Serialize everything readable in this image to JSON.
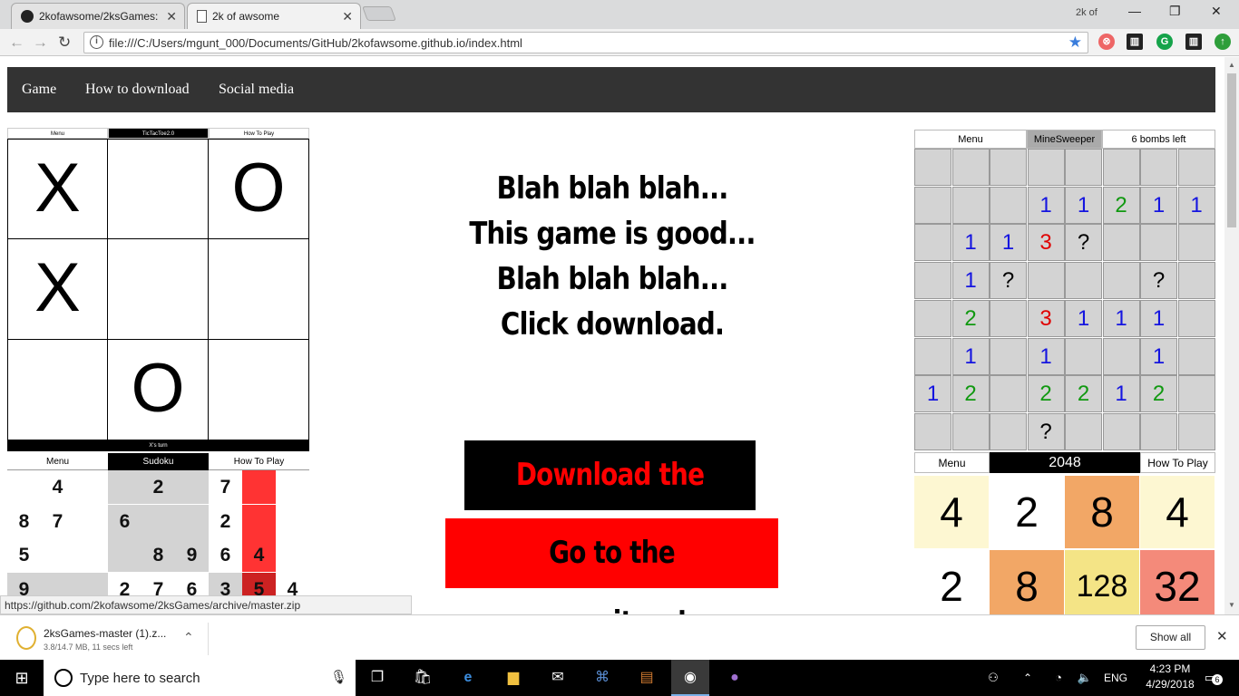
{
  "browser": {
    "tabs": [
      {
        "title": "2kofawsome/2ksGames: ",
        "close": "✕"
      },
      {
        "title": "2k of awsome",
        "close": "✕"
      }
    ],
    "profile": "2k of",
    "address": "file:///C:/Users/mgunt_000/Documents/GitHub/2kofawsome.github.io/index.html",
    "status_url": "https://github.com/2kofawsome/2ksGames/archive/master.zip"
  },
  "nav": {
    "items": [
      "Game",
      "How to download",
      "Social media"
    ]
  },
  "tictactoe": {
    "header": [
      "Menu",
      "TicTacToe2.0",
      "How To Play"
    ],
    "cells": [
      "X",
      "",
      "O",
      "X",
      "",
      "",
      "",
      "O",
      ""
    ],
    "footer": "X's turn"
  },
  "sudoku": {
    "header": [
      "Menu",
      "Sudoku",
      "How To Play"
    ],
    "rows": [
      [
        "",
        "4",
        "",
        "",
        "2",
        "",
        "7",
        "",
        ""
      ],
      [
        "8",
        "7",
        "",
        "6",
        "",
        "",
        "2",
        "",
        ""
      ],
      [
        "5",
        "",
        "",
        "",
        "8",
        "9",
        "6",
        "4",
        ""
      ],
      [
        "9",
        "",
        "",
        "2",
        "7",
        "6",
        "3",
        "5",
        "4"
      ]
    ]
  },
  "promo": {
    "lines": [
      "Blah blah blah...",
      "This game is good...",
      "Blah blah blah...",
      "Click download."
    ],
    "download_button": "Download the Zip!",
    "repo_button": "Go to the repository!"
  },
  "minesweeper": {
    "header": [
      "Menu",
      "MineSweeper",
      "6 bombs left"
    ],
    "rows": [
      [
        "",
        "",
        "",
        "",
        "",
        "",
        "",
        ""
      ],
      [
        "",
        "",
        "",
        "1",
        "1",
        "2",
        "1",
        "1"
      ],
      [
        "",
        "1",
        "1",
        "3",
        "?",
        "",
        "",
        ""
      ],
      [
        "",
        "1",
        "?",
        "",
        "",
        "",
        "?",
        ""
      ],
      [
        "",
        "2",
        "",
        "3",
        "1",
        "1",
        "1",
        ""
      ],
      [
        "",
        "1",
        "",
        "1",
        "",
        "",
        "1",
        ""
      ],
      [
        "1",
        "2",
        "",
        "2",
        "2",
        "1",
        "2",
        ""
      ],
      [
        "",
        "",
        "",
        "?",
        "",
        "",
        "",
        ""
      ]
    ]
  },
  "game2048": {
    "header": [
      "Menu",
      "2048",
      "How To Play"
    ],
    "rows": [
      [
        "4",
        "2",
        "8",
        "4"
      ],
      [
        "2",
        "8",
        "128",
        "32"
      ]
    ]
  },
  "download_shelf": {
    "file_name": "2ksGames-master (1).z...",
    "progress": "3.8/14.7 MB, 11 secs left",
    "show_all": "Show all"
  },
  "taskbar": {
    "search_placeholder": "Type here to search",
    "language": "ENG",
    "time": "4:23 PM",
    "date": "4/29/2018",
    "notification_count": "6"
  },
  "colors": {
    "nav_bg": "#333333",
    "download_button_bg": "#000000",
    "download_button_text": "#ff0000",
    "repo_button_bg": "#ff0000",
    "repo_button_text": "#000000"
  }
}
